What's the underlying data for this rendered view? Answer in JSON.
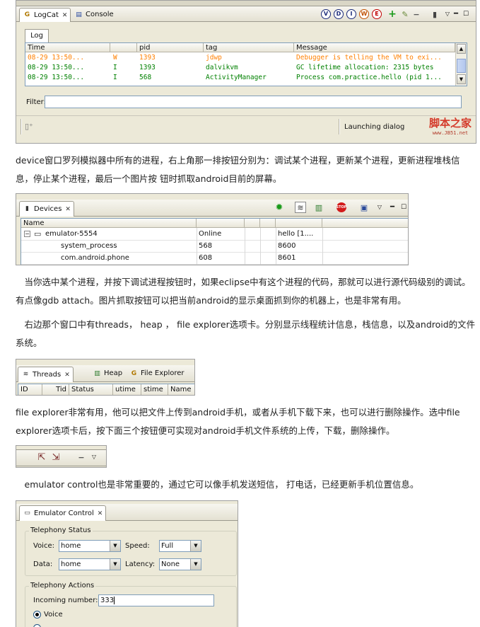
{
  "logcat": {
    "tabs": [
      {
        "label": "LogCat",
        "icon": "logcat-icon"
      },
      {
        "label": "Console",
        "icon": "console-icon"
      }
    ],
    "level_buttons": [
      "V",
      "D",
      "I",
      "W",
      "E"
    ],
    "subtab": "Log",
    "columns": [
      "Time",
      "",
      "pid",
      "tag",
      "Message"
    ],
    "rows": [
      {
        "time": "08-29 13:50...",
        "level": "W",
        "pid": "1393",
        "tag": "jdwp",
        "message": "Debugger is telling the VM to exi...",
        "color": "#ff8000"
      },
      {
        "time": "08-29 13:50...",
        "level": "I",
        "pid": "1393",
        "tag": "dalvikvm",
        "message": "GC lifetime allocation: 2315 bytes",
        "color": "#008000"
      },
      {
        "time": "08-29 13:50...",
        "level": "I",
        "pid": "568",
        "tag": "ActivityManager",
        "message": "Process com.practice.hello (pid 1...",
        "color": "#008000"
      }
    ],
    "filter_label": "Filter:",
    "filter_value": "",
    "status_text": "Launching dialog",
    "watermark": "脚本之家",
    "watermark_url": "www.JB51.net"
  },
  "para1": "device窗口罗列模拟器中所有的进程，右上角那一排按钮分别为：调试某个进程，更新某个进程，更新进程堆栈信息，停止某个进程，最后一个图片按 钮时抓取android目前的屏幕。",
  "devices": {
    "tab_label": "Devices",
    "header": "Name",
    "rows": [
      {
        "name": "emulator-5554",
        "col2": "Online",
        "col3": "",
        "col4": "",
        "col5": "hello [1...."
      },
      {
        "name": "system_process",
        "col2": "568",
        "col3": "",
        "col4": "",
        "col5": "8600"
      },
      {
        "name": "com.android.phone",
        "col2": "608",
        "col3": "",
        "col4": "",
        "col5": "8601"
      }
    ]
  },
  "para2": "　当你选中某个进程，并按下调试进程按钮时，如果eclipse中有这个进程的代码，那就可以进行源代码级别的调试。有点像gdb attach。图片抓取按钮可以把当前android的显示桌面抓到你的机器上，也是非常有用。",
  "para3": "　右边那个窗口中有threads， heap ， file explorer选项卡。分别显示线程统计信息，栈信息，以及android的文件系统。",
  "threads": {
    "tabs": [
      "Threads",
      "Heap",
      "File Explorer"
    ],
    "columns": [
      "ID",
      "Tid",
      "Status",
      "utime",
      "stime",
      "Name"
    ]
  },
  "para4": "file explorer非常有用，他可以把文件上传到android手机，或者从手机下载下来，也可以进行删除操作。选中file explorer选项卡后，按下面三个按钮便可实现对android手机文件系统的上传，下载，删除操作。",
  "para5": "　emulator control也是非常重要的，通过它可以像手机发送短信， 打电话，已经更新手机位置信息。",
  "emulator": {
    "tab_label": "Emulator Control",
    "telephony_status_title": "Telephony Status",
    "voice_label": "Voice:",
    "voice_value": "home",
    "speed_label": "Speed:",
    "speed_value": "Full",
    "data_label": "Data:",
    "data_value": "home",
    "latency_label": "Latency:",
    "latency_value": "None",
    "telephony_actions_title": "Telephony Actions",
    "incoming_label": "Incoming number:",
    "incoming_value": "333",
    "voice_radio": "Voice"
  }
}
